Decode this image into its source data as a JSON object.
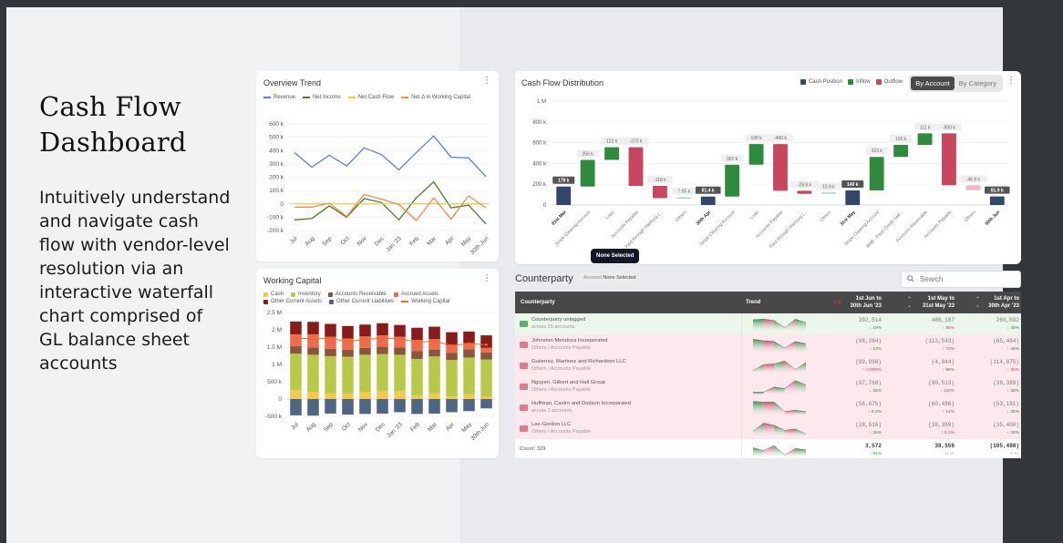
{
  "hero": {
    "title_line1": "Cash Flow",
    "title_line2": "Dashboard",
    "description": "Intuitively understand and navigate cash flow with vendor-level resolution via an interactive waterfall chart comprised of GL balance sheet accounts"
  },
  "overview": {
    "title": "Overview Trend",
    "menu_icon": "kebab-icon"
  },
  "working_capital": {
    "title": "Working Capital",
    "menu_icon": "kebab-icon"
  },
  "cashflow": {
    "title": "Cash Flow Distribution",
    "legend": [
      {
        "label": "Cash Position",
        "color": "#34466a"
      },
      {
        "label": "Inflow",
        "color": "#2e8b3e"
      },
      {
        "label": "Outflow",
        "color": "#c9465f"
      }
    ],
    "toggle": {
      "by_account": "By Account",
      "by_category": "By Category",
      "active": "By Account"
    },
    "tooltip": "None Selected"
  },
  "counterparty": {
    "title": "Counterparty",
    "chip_label": "Account",
    "chip_value": "None Selected",
    "search_placeholder": "Search",
    "headers": {
      "counterparty": "Counterparty",
      "trend": "Trend",
      "col1_line1": "1st Jun to",
      "col1_line2": "30th Jun '23",
      "col2_line1": "1st May to",
      "col2_line2": "31st May '23",
      "col3_line1": "1st Apr to",
      "col3_line2": "30th Apr '23"
    },
    "rows": [
      {
        "name": "Counterparty untagged",
        "sub": "across 25 accounts",
        "kind": "pos",
        "v1": "392,514",
        "c1": "↓ 19%",
        "c1dir": "down",
        "v2": "486,187",
        "c2": "↑ 88%",
        "c2dir": "up",
        "v3": "269,682",
        "c3": "↓ 48%",
        "c3dir": "down",
        "trend": [
          0.75,
          0.8,
          0.7,
          0.2,
          0.8,
          0.55
        ]
      },
      {
        "name": "Johnston-Mendoza Incorporated",
        "sub": "Others / Accounts Payable",
        "kind": "neg",
        "v1": "(98,284)",
        "c1": "↓ 13%",
        "c1dir": "down",
        "v2": "(113,543)",
        "c2": "↑ 73%",
        "c2dir": "up",
        "v3": "(65,464)",
        "c3": "↓ 48%",
        "c3dir": "down",
        "trend": [
          0.85,
          0.75,
          0.7,
          0.25,
          0.7,
          0.55
        ]
      },
      {
        "name": "Gutierrez, Martinez and Richardson LLC",
        "sub": "Others / Accounts Payable",
        "kind": "neg",
        "v1": "(89,898)",
        "c1": "↑ >1000%",
        "c1dir": "up",
        "v2": "(4,844)",
        "c2": "↓ 96%",
        "c2dir": "down",
        "v3": "(114,875)",
        "c3": "↑ 35%",
        "c3dir": "up",
        "trend": [
          0.15,
          0.55,
          0.6,
          0.8,
          0.2,
          0.7
        ]
      },
      {
        "name": "Nguyen, Gilbert and Hall Group",
        "sub": "Others / Accounts Payable",
        "kind": "neg",
        "v1": "(67,768)",
        "c1": "↓ 25%",
        "c1dir": "down",
        "v2": "(90,513)",
        "c2": "↑ 130%",
        "c2dir": "up",
        "v3": "(39,389)",
        "c3": "↓ 28%",
        "c3dir": "down",
        "trend": [
          0.1,
          0.1,
          0.45,
          0.35,
          0.9,
          0.6
        ]
      },
      {
        "name": "Huffman, Castro and Dodson Incorporated",
        "sub": "across 2 accounts",
        "kind": "neg",
        "v1": "(56,675)",
        "c1": "↓ 6.3%",
        "c1dir": "down",
        "v2": "(60,496)",
        "c2": "↑ 14%",
        "c2dir": "up",
        "v3": "(53,181)",
        "c3": "↓ 35%",
        "c3dir": "down",
        "trend": [
          0.9,
          0.85,
          0.85,
          0.2,
          0.3,
          0.2
        ]
      },
      {
        "name": "Lee-Gordon LLC",
        "sub": "Others / Accounts Payable",
        "kind": "neg",
        "v1": "(28,516)",
        "c1": "↓ 26%",
        "c1dir": "down",
        "v2": "(38,359)",
        "c2": "↑ 8.1%",
        "c2dir": "up",
        "v3": "(35,400)",
        "c3": "↓ 28%",
        "c3dir": "down",
        "trend": [
          0.3,
          0.85,
          0.7,
          0.35,
          0.45,
          0.1
        ]
      }
    ],
    "total": {
      "label": "Count: 329",
      "v1": "3,572",
      "c1": "↓ 91%",
      "v2": "38,556",
      "c2": "N.M.",
      "v3": "(105,498)",
      "c3": "N.M.",
      "trend": [
        0.6,
        0.4,
        0.75,
        0.1,
        0.55,
        0.45
      ]
    }
  },
  "colors": {
    "positive": "#2e8b3e",
    "negative": "#c9465f",
    "header_bg": "#484848"
  },
  "chart_data": [
    {
      "type": "line",
      "title": "Overview Trend",
      "categories": [
        "Jul",
        "Aug",
        "Sep",
        "Oct",
        "Nov",
        "Dec",
        "Jan '23",
        "Feb",
        "Mar",
        "Apr",
        "May",
        "30th Jun"
      ],
      "ylim": [
        -200000,
        600000
      ],
      "yticks": [
        {
          "v": 600000,
          "l": "600 k"
        },
        {
          "v": 500000,
          "l": "500 k"
        },
        {
          "v": 400000,
          "l": "400 k"
        },
        {
          "v": 300000,
          "l": "300 k"
        },
        {
          "v": 200000,
          "l": "200 k"
        },
        {
          "v": 100000,
          "l": "100 k"
        },
        {
          "v": 0,
          "l": "0"
        },
        {
          "v": -100000,
          "l": "-100 k"
        },
        {
          "v": -200000,
          "l": "-200 k"
        }
      ],
      "series": [
        {
          "name": "Revenue",
          "color": "#5b7fdc",
          "values": [
            385000,
            275000,
            365000,
            285000,
            420000,
            370000,
            255000,
            385000,
            510000,
            350000,
            345000,
            205000
          ]
        },
        {
          "name": "Net Income",
          "color": "#4f7a28",
          "values": [
            -120000,
            -110000,
            -15000,
            -100000,
            40000,
            10000,
            -120000,
            45000,
            165000,
            -30000,
            -10000,
            -150000
          ]
        },
        {
          "name": "Net Cash Flow",
          "color": "#f2c94c",
          "values": [
            0,
            0,
            0,
            0,
            0,
            0,
            0,
            0,
            0,
            0,
            0,
            0
          ]
        },
        {
          "name": "Net Δ in Working Capital",
          "color": "#f08a4b",
          "values": [
            -25000,
            -25000,
            5000,
            -95000,
            70000,
            35000,
            -5000,
            -125000,
            45000,
            -115000,
            60000,
            -30000
          ]
        }
      ],
      "grid": true,
      "legend": "top"
    },
    {
      "type": "bar",
      "stacked": true,
      "title": "Working Capital",
      "categories": [
        "Jul",
        "Aug",
        "Sep",
        "Oct",
        "Nov",
        "Dec",
        "Jan '23",
        "Feb",
        "Mar",
        "Apr",
        "May",
        "30th Jun"
      ],
      "ylim": [
        -500000,
        2500000
      ],
      "yticks": [
        {
          "v": 2500000,
          "l": "2.5 M"
        },
        {
          "v": 2000000,
          "l": "2 M"
        },
        {
          "v": 1500000,
          "l": "1.5 M"
        },
        {
          "v": 1000000,
          "l": "1 M"
        },
        {
          "v": 500000,
          "l": "500 k"
        },
        {
          "v": 0,
          "l": "0"
        },
        {
          "v": -500000,
          "l": "-500 k"
        }
      ],
      "series": [
        {
          "name": "Cash",
          "color": "#f2c94c",
          "values": [
            260000,
            210000,
            170000,
            160000,
            210000,
            240000,
            230000,
            110000,
            170000,
            80000,
            140000,
            80000
          ]
        },
        {
          "name": "Inventory",
          "color": "#b8c94a",
          "values": [
            1050000,
            1070000,
            1070000,
            1060000,
            1070000,
            1060000,
            1050000,
            1050000,
            1060000,
            1050000,
            1060000,
            1060000
          ]
        },
        {
          "name": "Accounts Receivable",
          "color": "#8a5538",
          "values": [
            220000,
            210000,
            210000,
            200000,
            200000,
            210000,
            210000,
            230000,
            200000,
            200000,
            240000,
            210000
          ]
        },
        {
          "name": "Accrued Assets",
          "color": "#ef6b4a",
          "values": [
            340000,
            380000,
            350000,
            330000,
            330000,
            330000,
            310000,
            320000,
            300000,
            220000,
            180000,
            130000
          ]
        },
        {
          "name": "Other Current Assets",
          "color": "#8b1a1a",
          "values": [
            370000,
            360000,
            370000,
            360000,
            340000,
            350000,
            340000,
            350000,
            360000,
            380000,
            330000,
            360000
          ]
        },
        {
          "name": "Other Current Liabilities",
          "color": "#4f6584",
          "values": [
            -470000,
            -480000,
            -420000,
            -450000,
            -430000,
            -420000,
            -380000,
            -430000,
            -420000,
            -380000,
            -350000,
            -270000
          ]
        }
      ],
      "line": {
        "name": "Working Capital",
        "color": "#f06a2a",
        "values": [
          1760000,
          1740000,
          1750000,
          1660000,
          1720000,
          1760000,
          1750000,
          1640000,
          1670000,
          1550000,
          1600000,
          1570000
        ]
      },
      "grid": true,
      "legend": "top"
    },
    {
      "type": "bar",
      "subtype": "waterfall",
      "title": "Cash Flow Distribution",
      "ylim": [
        0,
        1000000
      ],
      "yticks": [
        {
          "v": 1000000,
          "l": "1 M"
        },
        {
          "v": 800000,
          "l": "800 k"
        },
        {
          "v": 600000,
          "l": "600 k"
        },
        {
          "v": 400000,
          "l": "400 k"
        },
        {
          "v": 200000,
          "l": "200 k"
        },
        {
          "v": 0,
          "l": "0"
        }
      ],
      "steps": [
        {
          "label": "31st Mar",
          "kind": "position",
          "start": 0,
          "end": 178000,
          "text": "178 k"
        },
        {
          "label": "Stripe Clearing Account",
          "kind": "inflow",
          "start": 178000,
          "end": 434000,
          "text": "256 k"
        },
        {
          "label": "Loan",
          "kind": "inflow",
          "start": 434000,
          "end": 556000,
          "text": "122 k"
        },
        {
          "label": "Accounts Payable",
          "kind": "outflow",
          "start": 556000,
          "end": 184000,
          "text": "-372 k"
        },
        {
          "label": "Paid through Warburg (...",
          "kind": "outflow",
          "start": 184000,
          "end": 66000,
          "text": "-118 k"
        },
        {
          "label": "Others",
          "kind": "inflow-faint",
          "start": 66000,
          "end": 73000,
          "text": "7.05 k"
        },
        {
          "label": "30th Apr",
          "kind": "position",
          "start": 0,
          "end": 81400,
          "text": "81.4 k"
        },
        {
          "label": "Stripe Clearing Account",
          "kind": "inflow",
          "start": 81400,
          "end": 388000,
          "text": "307 k"
        },
        {
          "label": "Loan",
          "kind": "inflow",
          "start": 388000,
          "end": 587000,
          "text": "199 k"
        },
        {
          "label": "Accounts Payable",
          "kind": "outflow",
          "start": 587000,
          "end": 137000,
          "text": "-450 k"
        },
        {
          "label": "Paid through Warburg (...",
          "kind": "outflow",
          "start": 137000,
          "end": 108000,
          "text": "-28.8 k"
        },
        {
          "label": "Others",
          "kind": "inflow-faint",
          "start": 108000,
          "end": 119000,
          "text": "10.9 k"
        },
        {
          "label": "31st May",
          "kind": "position",
          "start": 0,
          "end": 140000,
          "text": "140 k"
        },
        {
          "label": "Stripe Clearing Account",
          "kind": "inflow",
          "start": 140000,
          "end": 463000,
          "text": "323 k"
        },
        {
          "label": "BNB - Payp Credit Sett...",
          "kind": "inflow",
          "start": 463000,
          "end": 579000,
          "text": "116 k"
        },
        {
          "label": "Accounts Receivable",
          "kind": "inflow",
          "start": 579000,
          "end": 690000,
          "text": "111 k"
        },
        {
          "label": "Accounts Payable",
          "kind": "outflow",
          "start": 690000,
          "end": 190000,
          "text": "-500 k"
        },
        {
          "label": "Others",
          "kind": "outflow-faint",
          "start": 190000,
          "end": 143000,
          "text": "-46.8 k"
        },
        {
          "label": "30th Jun",
          "kind": "position",
          "start": 0,
          "end": 81900,
          "text": "81.9 k"
        }
      ],
      "legend": "top-right"
    }
  ]
}
